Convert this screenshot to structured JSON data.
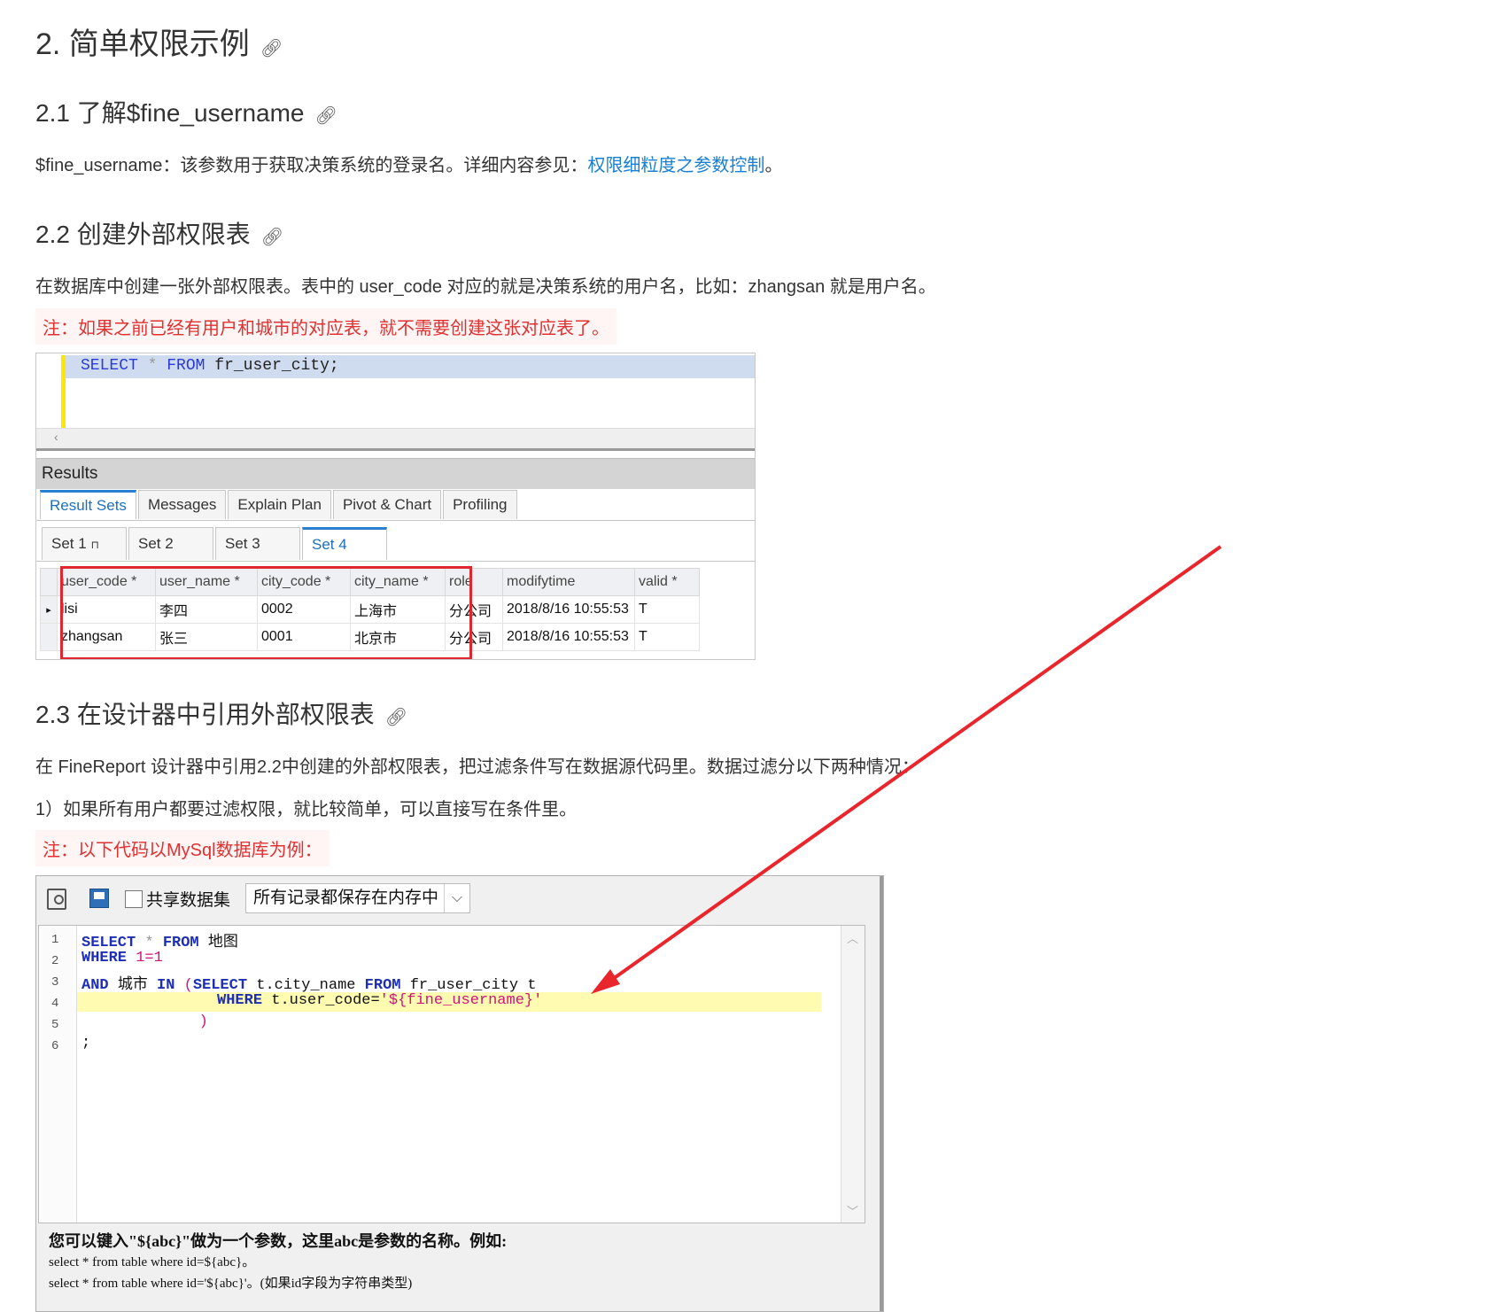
{
  "section": {
    "title": "2. 简单权限示例",
    "anchor_icon": "link-icon"
  },
  "sub1": {
    "title": "2.1 了解$fine_username",
    "text": "$fine_username：该参数用于获取决策系统的登录名。详细内容参见：",
    "link": "权限细粒度之参数控制",
    "suffix": "。"
  },
  "sub2": {
    "title": "2.2 创建外部权限表",
    "text": "在数据库中创建一张外部权限表。表中的 user_code 对应的就是决策系统的用户名，比如：zhangsan 就是用户名。",
    "note": "注：如果之前已经有用户和城市的对应表，就不需要创建这张对应表了。"
  },
  "shot1": {
    "sql_select": "SELECT",
    "sql_star": "*",
    "sql_from": "FROM",
    "sql_table": "fr_user_city;",
    "scroll_left": "‹",
    "results_title": "Results",
    "tabs": [
      "Result Sets",
      "Messages",
      "Explain Plan",
      "Pivot & Chart",
      "Profiling"
    ],
    "sets": [
      "Set 1",
      "Set 2",
      "Set 3",
      "Set 4"
    ],
    "set1_pin": "⊓",
    "columns": [
      "user_code *",
      "user_name *",
      "city_code *",
      "city_name *",
      "role",
      "modifytime",
      "valid *"
    ],
    "rows": [
      [
        "lisi",
        "李四",
        "0002",
        "上海市",
        "分公司",
        "2018/8/16 10:55:53",
        "T"
      ],
      [
        "zhangsan",
        "张三",
        "0001",
        "北京市",
        "分公司",
        "2018/8/16 10:55:53",
        "T"
      ]
    ],
    "row_marker": "▸"
  },
  "sub3": {
    "title": "2.3 在设计器中引用外部权限表",
    "text": "在 FineReport 设计器中引用2.2中创建的外部权限表，把过滤条件写在数据源代码里。数据过滤分以下两种情况：",
    "text2": "1）如果所有用户都要过滤权限，就比较简单，可以直接写在条件里。",
    "note": "注：以下代码以MySql数据库为例："
  },
  "shot2": {
    "share_label": "共享数据集",
    "memory_option": "所有记录都保存在内存中",
    "line_numbers": [
      "1",
      "2",
      "3",
      "4",
      "5",
      "6"
    ],
    "l1_select": "SELECT",
    "l1_star": "*",
    "l1_from": "FROM",
    "l1_table": "地图",
    "l2_where": "WHERE",
    "l2_cond": "1=1",
    "l3_and": "AND",
    "l3_col": "城市",
    "l3_in": "IN",
    "l3_paren": "(",
    "l3_select": "SELECT",
    "l3_field": "t.city_name",
    "l3_from": "FROM",
    "l3_table": "fr_user_city t",
    "l4_where": "WHERE",
    "l4_field": "t.user_code=",
    "l4_value": "'${fine_username}'",
    "l5_paren": ")",
    "l6_semicolon": ";",
    "hint_line1": "您可以键入\"${abc}\"做为一个参数，这里abc是参数的名称。例如:",
    "hint_line2": "select * from table where id=${abc}。",
    "hint_line3": "select * from table where id='${abc}'。(如果id字段为字符串类型)"
  },
  "colors": {
    "link": "#1a7fd4",
    "note_red": "#e03131",
    "highlight_box": "#e0272f",
    "arrow": "#e8262b",
    "keyword": "#1c2fb5",
    "string": "#d0147a"
  }
}
